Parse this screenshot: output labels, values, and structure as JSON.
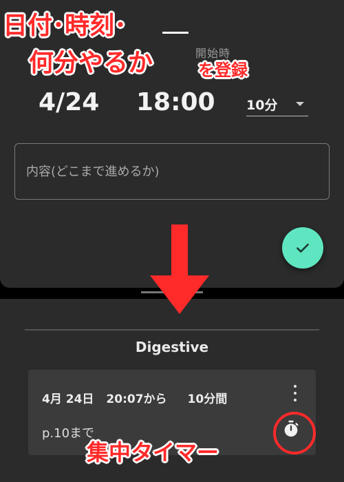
{
  "form": {
    "header_fragment": "開始時",
    "date": "4/24",
    "time": "18:00",
    "duration": "10分",
    "content_placeholder": "内容(どこまで進めるか)"
  },
  "list": {
    "title": "Digestive",
    "entries": [
      {
        "date": "4月 24日",
        "time": "20:07から",
        "duration": "10分間",
        "note": "p.10まで"
      }
    ]
  },
  "annotations": {
    "line1": "日付･時刻･",
    "line2": "何分やるか",
    "line3": "を登録",
    "timer_label": "集中タイマー"
  },
  "colors": {
    "panel": "#2b2b2b",
    "card": "#3b3b3b",
    "accent": "#5fe6c1",
    "annotation": "#ff2a2a"
  }
}
